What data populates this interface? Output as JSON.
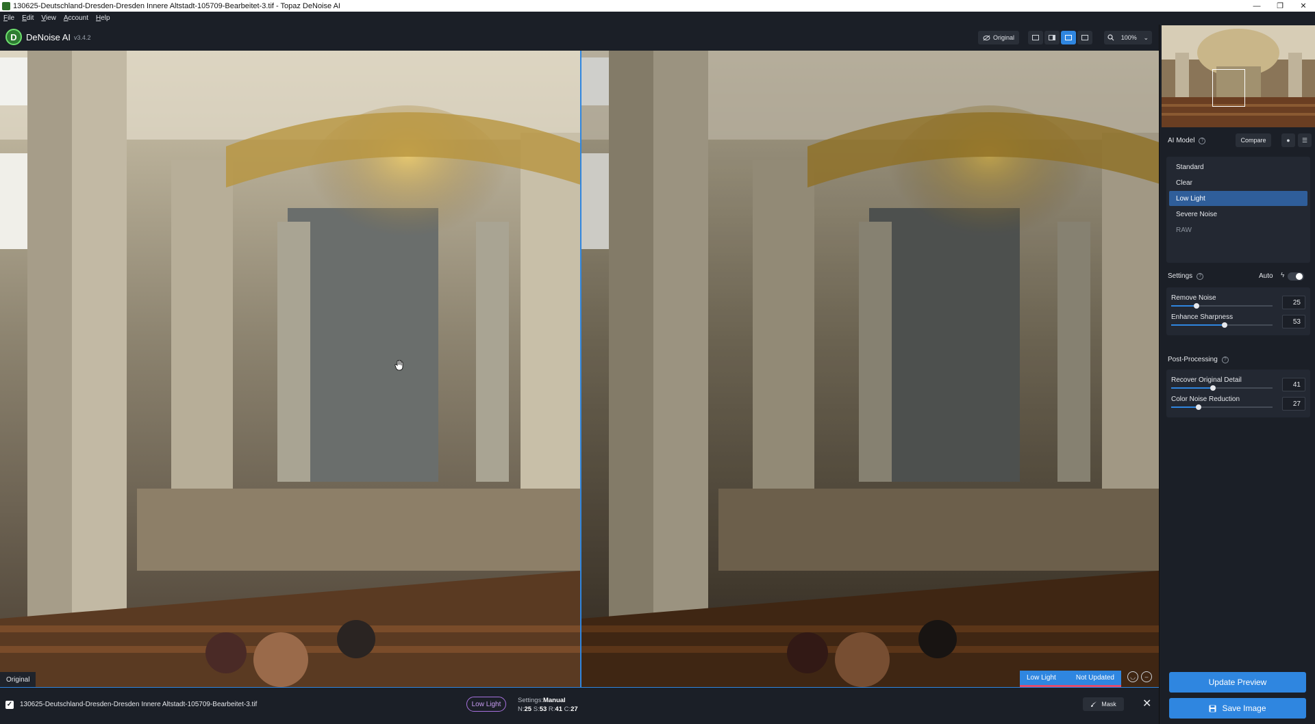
{
  "window": {
    "title": "130625-Deutschland-Dresden-Dresden Innere Altstadt-105709-Bearbeitet-3.tif - Topaz DeNoise AI",
    "controls": {
      "minimize": "—",
      "restore": "❐",
      "close": "✕"
    }
  },
  "menu": [
    "File",
    "Edit",
    "View",
    "Account",
    "Help"
  ],
  "app": {
    "logo_letter": "D",
    "name": "DeNoise AI",
    "version": "v3.4.2"
  },
  "toolbar": {
    "original_label": "Original",
    "zoom_label": "100%",
    "views": [
      "single-view",
      "split-view",
      "side-by-side-view",
      "grid-view"
    ],
    "active_view": "side-by-side-view"
  },
  "viewer": {
    "left_label": "Original",
    "status_model": "Low Light",
    "status_text": "Not Updated"
  },
  "file": {
    "checked": true,
    "name": "130625-Deutschland-Dresden-Dresden Innere Altstadt-105709-Bearbeitet-3.tif",
    "model": "Low Light",
    "settings_label": "Settings:",
    "settings_mode": "Manual",
    "stats": [
      {
        "key": "N:",
        "value": "25"
      },
      {
        "key": "S:",
        "value": "53"
      },
      {
        "key": "R:",
        "value": "41"
      },
      {
        "key": "C:",
        "value": "27"
      }
    ],
    "mask_label": "Mask"
  },
  "sidebar": {
    "ai_model_title": "AI Model",
    "compare_label": "Compare",
    "models": [
      {
        "label": "Standard",
        "state": "normal"
      },
      {
        "label": "Clear",
        "state": "normal"
      },
      {
        "label": "Low Light",
        "state": "active"
      },
      {
        "label": "Severe Noise",
        "state": "normal"
      },
      {
        "label": "RAW",
        "state": "dim"
      }
    ],
    "settings_title": "Settings",
    "auto_label": "Auto",
    "settings": [
      {
        "label": "Remove Noise",
        "value": "25",
        "fraction": 0.25
      },
      {
        "label": "Enhance Sharpness",
        "value": "53",
        "fraction": 0.53
      }
    ],
    "post_title": "Post-Processing",
    "post": [
      {
        "label": "Recover Original Detail",
        "value": "41",
        "fraction": 0.41
      },
      {
        "label": "Color Noise Reduction",
        "value": "27",
        "fraction": 0.27
      }
    ],
    "update_label": "Update Preview",
    "save_label": "Save Image"
  },
  "colors": {
    "accent": "#2f86e0",
    "model_pill": "#a872e0",
    "status_underline": "#e34b6a"
  }
}
